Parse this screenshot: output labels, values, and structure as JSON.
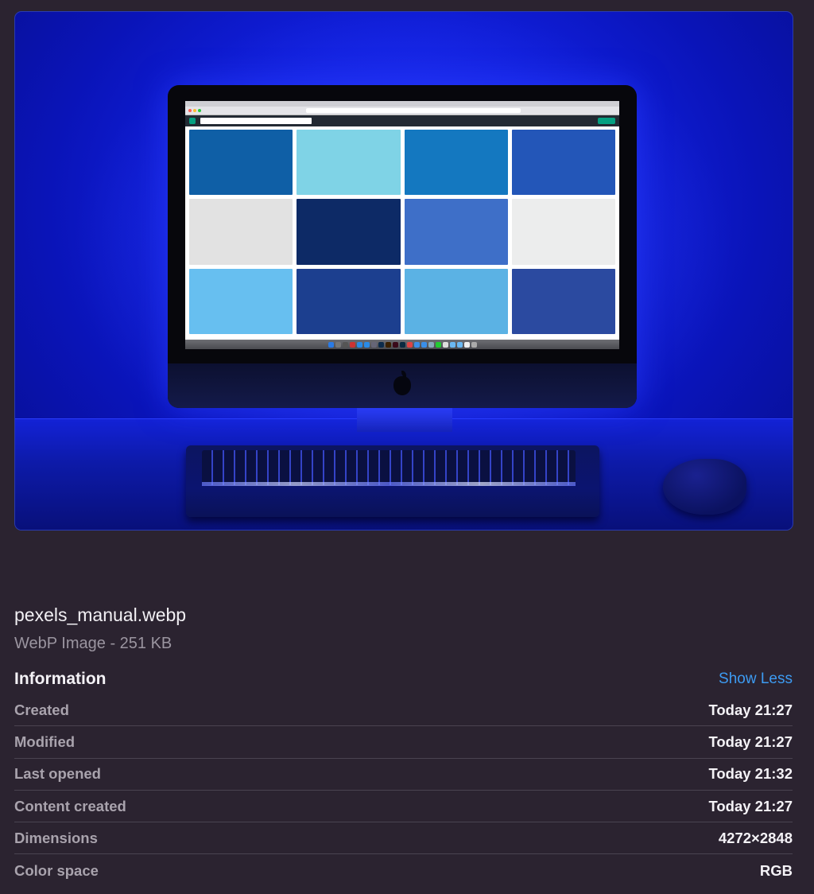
{
  "preview": {
    "alt": "iMac on a desk lit with blue light, screen showing a grid of blue photos in a browser",
    "accent_color": "#1120e0",
    "tiles": [
      "#0f5fa6",
      "#7fd3e6",
      "#1478c0",
      "#2356b8",
      "#e2e2e2",
      "#0d2a66",
      "#3e6fc8",
      "#eceded",
      "#67bff0",
      "#1c3f8f",
      "#5bb2e4",
      "#2b4aa0"
    ],
    "dock_colors": [
      "#2a7be6",
      "#777",
      "#555",
      "#c33",
      "#2a8be6",
      "#2a8be6",
      "#667",
      "#0c2b4b",
      "#3b2100",
      "#3a0a1a",
      "#0b2a40",
      "#d44",
      "#3a8fe8",
      "#3a8fe8",
      "#8ab",
      "#2c3",
      "#ddd",
      "#6ab8f2",
      "#6ab8f2",
      "#eee",
      "#aaa"
    ]
  },
  "file": {
    "name": "pexels_manual.webp",
    "kind_size": "WebP Image - 251 KB"
  },
  "information": {
    "title": "Information",
    "toggle_label": "Show Less",
    "rows": [
      {
        "key": "Created",
        "value": "Today 21:27"
      },
      {
        "key": "Modified",
        "value": "Today 21:27"
      },
      {
        "key": "Last opened",
        "value": "Today 21:32"
      },
      {
        "key": "Content created",
        "value": "Today 21:27"
      },
      {
        "key": "Dimensions",
        "value": "4272×2848"
      },
      {
        "key": "Color space",
        "value": "RGB"
      }
    ]
  },
  "colors": {
    "background": "#2b2330",
    "link": "#3d9bf2",
    "label": "#a9a3ad",
    "value": "#f4f2f6"
  }
}
